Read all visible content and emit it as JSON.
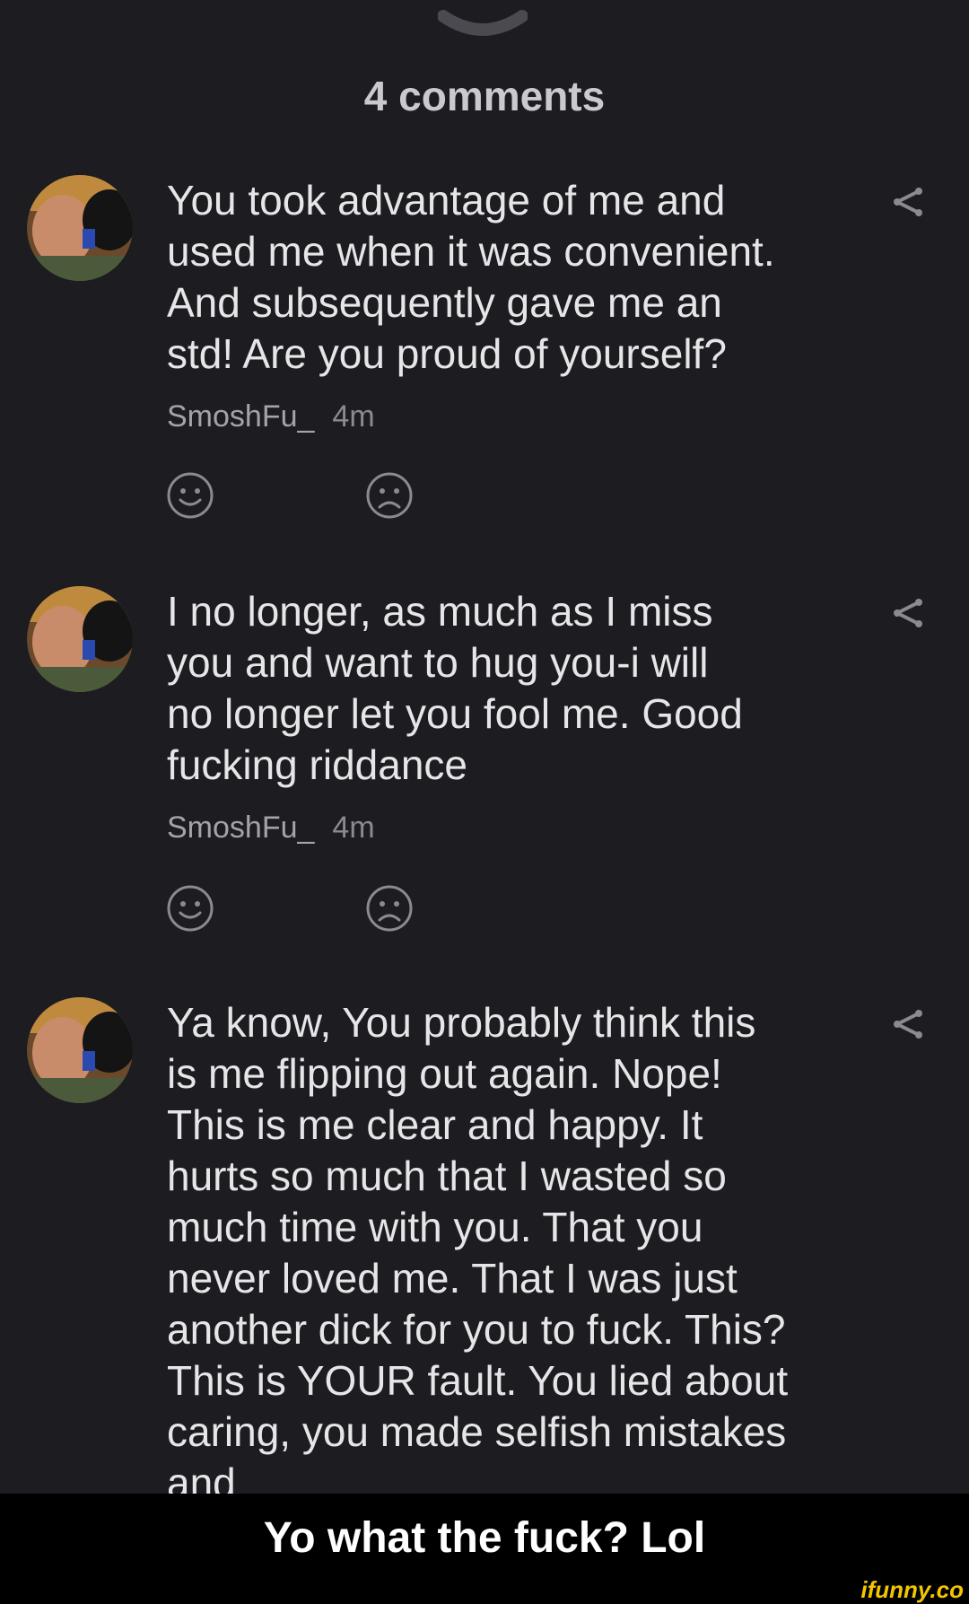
{
  "header": {
    "comments_count_label": "4 comments"
  },
  "comments": [
    {
      "text": "You took advantage of me and\nused me when it was convenient.\nAnd subsequently gave me an\nstd! Are you proud of yourself?",
      "author": "SmoshFu_",
      "time": "4m"
    },
    {
      "text": "I no longer, as much as I miss\nyou and want to hug you-i will\nno longer let you fool me. Good\nfucking riddance",
      "author": "SmoshFu_",
      "time": "4m"
    },
    {
      "text": "Ya know, You probably think this\nis me flipping out again. Nope!\nThis is me clear and happy. It\nhurts so much that I wasted so\nmuch time with you. That you\nnever loved me. That I was just\nanother dick for you to fuck. This?\nThis is YOUR fault. You lied about\ncaring, you made selfish mistakes\nand"
    }
  ],
  "caption": "Yo what the fuck? Lol",
  "watermark": "ifunny.co",
  "icons": {
    "sheet_handle": "chevron-down-icon",
    "share": "share-icon",
    "like": "smile-icon",
    "dislike": "frown-icon"
  },
  "colors": {
    "background": "#1c1c21",
    "text": "#e6e6e8",
    "muted": "#a3a3a9",
    "caption_bar": "#000000",
    "watermark": "#f2c500"
  }
}
